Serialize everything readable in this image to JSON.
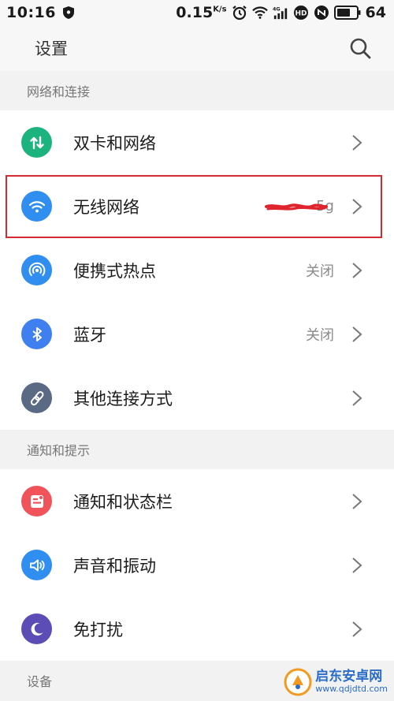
{
  "status_bar": {
    "time": "10:16",
    "speed_value": "0.15",
    "speed_unit": "K/s",
    "battery_percent": "64"
  },
  "app_bar": {
    "title": "设置"
  },
  "sections": [
    {
      "header": "网络和连接",
      "items": [
        {
          "label": "双卡和网络",
          "value": "",
          "icon": "swap-arrows-icon",
          "color": "#1db37e"
        },
        {
          "label": "无线网络",
          "value": "5g",
          "icon": "wifi-icon",
          "color": "#2f8ef0"
        },
        {
          "label": "便携式热点",
          "value": "关闭",
          "icon": "hotspot-icon",
          "color": "#2f8ef0"
        },
        {
          "label": "蓝牙",
          "value": "关闭",
          "icon": "bluetooth-icon",
          "color": "#3f7ff0"
        },
        {
          "label": "其他连接方式",
          "value": "",
          "icon": "link-icon",
          "color": "#5a6a84"
        }
      ]
    },
    {
      "header": "通知和提示",
      "items": [
        {
          "label": "通知和状态栏",
          "value": "",
          "icon": "notification-icon",
          "color": "#f1535b"
        },
        {
          "label": "声音和振动",
          "value": "",
          "icon": "speaker-icon",
          "color": "#2f8ef0"
        },
        {
          "label": "免打扰",
          "value": "",
          "icon": "moon-icon",
          "color": "#5b4db5"
        }
      ]
    },
    {
      "header": "设备",
      "items": []
    }
  ],
  "watermark": {
    "name": "启东安卓网",
    "url": "www.qdjdtd.com"
  }
}
